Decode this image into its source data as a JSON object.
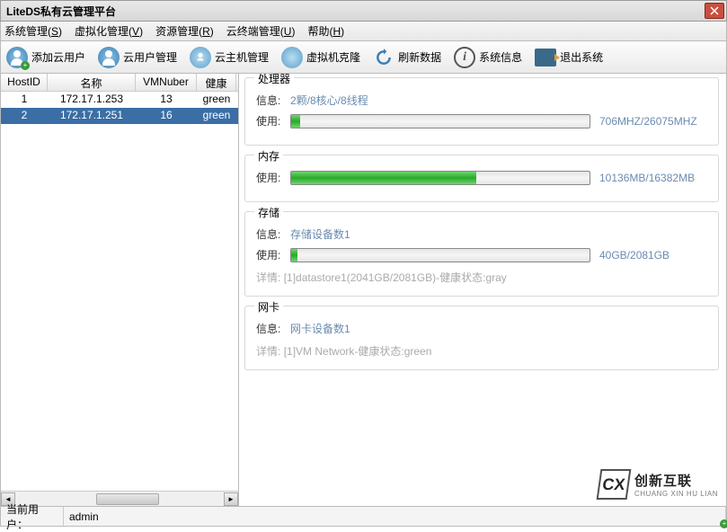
{
  "titlebar": {
    "title": "LiteDS私有云管理平台"
  },
  "menubar": {
    "items": [
      {
        "label": "系统管理",
        "accel": "S"
      },
      {
        "label": "虚拟化管理",
        "accel": "V"
      },
      {
        "label": "资源管理",
        "accel": "R"
      },
      {
        "label": "云终端管理",
        "accel": "U"
      },
      {
        "label": "帮助",
        "accel": "H"
      }
    ]
  },
  "toolbar": {
    "add_user": "添加云用户",
    "manage_user": "云用户管理",
    "host_mgmt": "云主机管理",
    "vm_clone": "虚拟机克隆",
    "refresh": "刷新数据",
    "sysinfo": "系统信息",
    "exit": "退出系统"
  },
  "host_table": {
    "headers": {
      "hostid": "HostID",
      "name": "名称",
      "vmnum": "VMNuber",
      "health": "健康"
    },
    "rows": [
      {
        "hostid": "1",
        "name": "172.17.1.253",
        "vmnum": "13",
        "health": "green",
        "selected": false
      },
      {
        "hostid": "2",
        "name": "172.17.1.251",
        "vmnum": "16",
        "health": "green",
        "selected": true
      }
    ]
  },
  "cpu": {
    "title": "处理器",
    "info_label": "信息:",
    "info_text": "2颗/8核心/8线程",
    "use_label": "使用:",
    "usage_text": "706MHZ/26075MHZ",
    "fill_pct": 3
  },
  "mem": {
    "title": "内存",
    "use_label": "使用:",
    "usage_text": "10136MB/16382MB",
    "fill_pct": 62
  },
  "storage": {
    "title": "存储",
    "info_label": "信息:",
    "info_text": "存储设备数1",
    "use_label": "使用:",
    "usage_text": "40GB/2081GB",
    "fill_pct": 2,
    "detail_label": "详情:",
    "detail_text": "[1]datastore1(2041GB/2081GB)-健康状态:gray"
  },
  "nic": {
    "title": "网卡",
    "info_label": "信息:",
    "info_text": "网卡设备数1",
    "detail_label": "详情:",
    "detail_text": "[1]VM Network-健康状态:green"
  },
  "statusbar": {
    "user_label": "当前用户：",
    "user_value": "admin"
  },
  "watermark": {
    "logo": "CX",
    "cn": "创新互联",
    "en": "CHUANG XIN HU LIAN"
  }
}
